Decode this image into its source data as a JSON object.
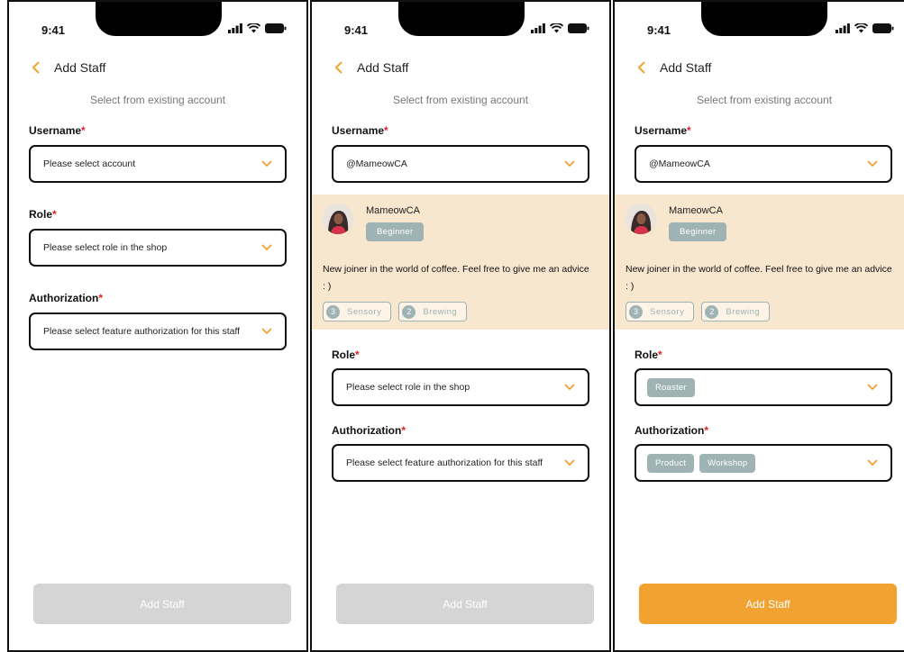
{
  "colors": {
    "accent": "#f2a231",
    "disabled_button": "#d5d5d5",
    "required_asterisk": "#e02020",
    "chip": "#9fb3b5",
    "profile_card": "#f8e7cf"
  },
  "screens": [
    {
      "status": {
        "time": "9:41"
      },
      "header": {
        "back_icon": "chevron-left-icon",
        "title": "Add Staff"
      },
      "subtitle": "Select from existing account",
      "username": {
        "label": "Username",
        "required": "*",
        "value": "Please select account"
      },
      "role": {
        "label": "Role",
        "required": "*",
        "value": "Please select role in the shop"
      },
      "authorization": {
        "label": "Authorization",
        "required": "*",
        "value": "Please select feature authorization for this staff"
      },
      "submit": {
        "label": "Add Staff",
        "state": "disabled"
      }
    },
    {
      "status": {
        "time": "9:41"
      },
      "header": {
        "back_icon": "chevron-left-icon",
        "title": "Add Staff"
      },
      "subtitle": "Select from existing account",
      "username": {
        "label": "Username",
        "required": "*",
        "value": "@MameowCA"
      },
      "profile": {
        "name": "MameowCA",
        "level": "Beginner",
        "bio": "New joiner in the world of coffee. Feel free to give me an advice : )",
        "skills": [
          {
            "count": "3",
            "name": "Sensory"
          },
          {
            "count": "2",
            "name": "Brewing"
          }
        ]
      },
      "role": {
        "label": "Role",
        "required": "*",
        "value": "Please select role in the shop"
      },
      "authorization": {
        "label": "Authorization",
        "required": "*",
        "value": "Please select feature authorization for this staff"
      },
      "submit": {
        "label": "Add Staff",
        "state": "disabled"
      }
    },
    {
      "status": {
        "time": "9:41"
      },
      "header": {
        "back_icon": "chevron-left-icon",
        "title": "Add Staff"
      },
      "subtitle": "Select from existing account",
      "username": {
        "label": "Username",
        "required": "*",
        "value": "@MameowCA"
      },
      "profile": {
        "name": "MameowCA",
        "level": "Beginner",
        "bio": "New joiner in the world of coffee. Feel free to give me an advice : )",
        "skills": [
          {
            "count": "3",
            "name": "Sensory"
          },
          {
            "count": "2",
            "name": "Brewing"
          }
        ]
      },
      "role": {
        "label": "Role",
        "required": "*",
        "chips": [
          "Roaster"
        ]
      },
      "authorization": {
        "label": "Authorization",
        "required": "*",
        "chips": [
          "Product",
          "Workshop"
        ]
      },
      "submit": {
        "label": "Add Staff",
        "state": "enabled"
      }
    }
  ]
}
